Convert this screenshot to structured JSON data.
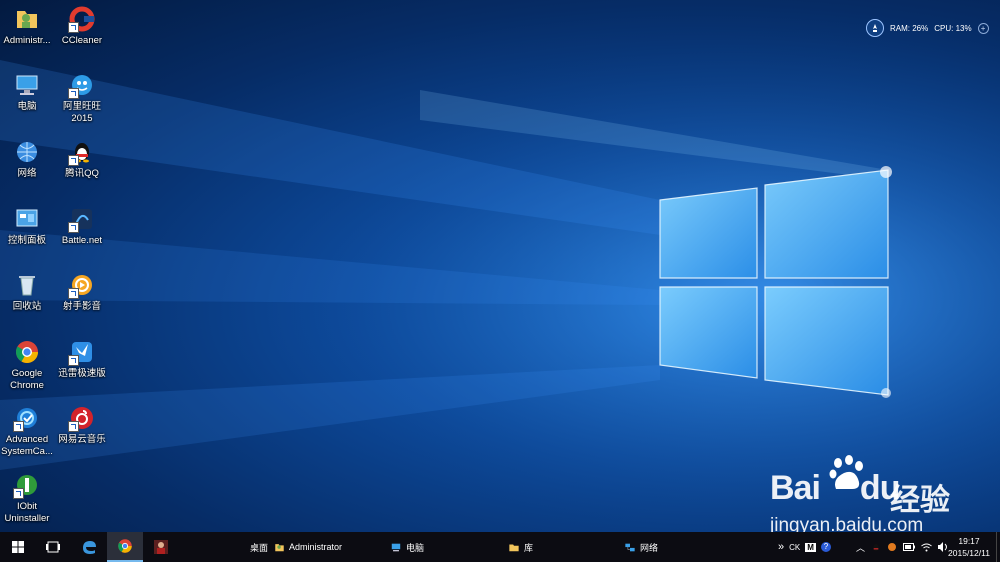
{
  "desktop": {
    "icons": [
      {
        "label": "Administr...",
        "icon": "user-folder-icon"
      },
      {
        "label": "CCleaner",
        "icon": "ccleaner-icon"
      },
      {
        "label": "电脑",
        "icon": "computer-icon"
      },
      {
        "label": "阿里旺旺\n2015",
        "icon": "aliwangwang-icon"
      },
      {
        "label": "网络",
        "icon": "network-icon"
      },
      {
        "label": "腾讯QQ",
        "icon": "qq-icon"
      },
      {
        "label": "控制面板",
        "icon": "control-panel-icon"
      },
      {
        "label": "Battle.net",
        "icon": "battlenet-icon"
      },
      {
        "label": "回收站",
        "icon": "recycle-bin-icon"
      },
      {
        "label": "射手影音",
        "icon": "shooter-player-icon"
      },
      {
        "label": "Google\nChrome",
        "icon": "chrome-icon"
      },
      {
        "label": "迅雷极速版",
        "icon": "thunder-icon"
      },
      {
        "label": "Advanced\nSystemCa...",
        "icon": "advanced-systemcare-icon"
      },
      {
        "label": "网易云音乐",
        "icon": "netease-music-icon"
      },
      {
        "label": "IObit\nUninstaller",
        "icon": "iobit-uninstaller-icon"
      }
    ]
  },
  "monitor": {
    "ram": "RAM: 26%",
    "cpu": "CPU: 13%"
  },
  "watermark": {
    "brand": "Bai",
    "brand_suffix": "du",
    "cn": "经验",
    "url": "jingyan.baidu.com"
  },
  "taskbar": {
    "toolbars": {
      "desktop": "桌面",
      "administrator": "Administrator",
      "computer": "电脑",
      "library": "库",
      "network": "网络"
    },
    "tray": {
      "chevron": "»",
      "ime": "CK",
      "m": "M"
    },
    "clock": {
      "time": "19:17",
      "date": "2015/12/11"
    }
  },
  "colors": {
    "accent": "#76b9ed",
    "taskbar": "#0c0c12"
  }
}
